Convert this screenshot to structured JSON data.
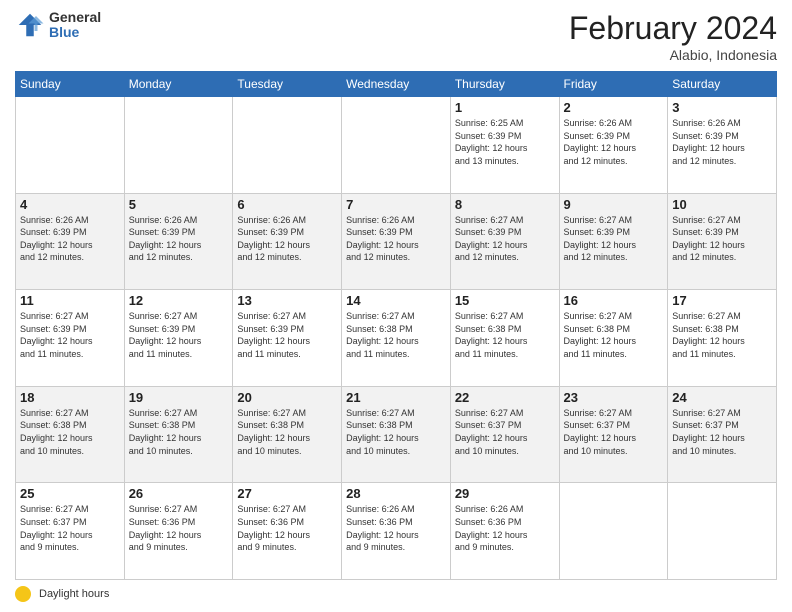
{
  "logo": {
    "general": "General",
    "blue": "Blue"
  },
  "title": "February 2024",
  "subtitle": "Alabio, Indonesia",
  "days_of_week": [
    "Sunday",
    "Monday",
    "Tuesday",
    "Wednesday",
    "Thursday",
    "Friday",
    "Saturday"
  ],
  "footer": {
    "label": "Daylight hours"
  },
  "weeks": [
    [
      {
        "day": "",
        "info": ""
      },
      {
        "day": "",
        "info": ""
      },
      {
        "day": "",
        "info": ""
      },
      {
        "day": "",
        "info": ""
      },
      {
        "day": "1",
        "info": "Sunrise: 6:25 AM\nSunset: 6:39 PM\nDaylight: 12 hours\nand 13 minutes."
      },
      {
        "day": "2",
        "info": "Sunrise: 6:26 AM\nSunset: 6:39 PM\nDaylight: 12 hours\nand 12 minutes."
      },
      {
        "day": "3",
        "info": "Sunrise: 6:26 AM\nSunset: 6:39 PM\nDaylight: 12 hours\nand 12 minutes."
      }
    ],
    [
      {
        "day": "4",
        "info": "Sunrise: 6:26 AM\nSunset: 6:39 PM\nDaylight: 12 hours\nand 12 minutes."
      },
      {
        "day": "5",
        "info": "Sunrise: 6:26 AM\nSunset: 6:39 PM\nDaylight: 12 hours\nand 12 minutes."
      },
      {
        "day": "6",
        "info": "Sunrise: 6:26 AM\nSunset: 6:39 PM\nDaylight: 12 hours\nand 12 minutes."
      },
      {
        "day": "7",
        "info": "Sunrise: 6:26 AM\nSunset: 6:39 PM\nDaylight: 12 hours\nand 12 minutes."
      },
      {
        "day": "8",
        "info": "Sunrise: 6:27 AM\nSunset: 6:39 PM\nDaylight: 12 hours\nand 12 minutes."
      },
      {
        "day": "9",
        "info": "Sunrise: 6:27 AM\nSunset: 6:39 PM\nDaylight: 12 hours\nand 12 minutes."
      },
      {
        "day": "10",
        "info": "Sunrise: 6:27 AM\nSunset: 6:39 PM\nDaylight: 12 hours\nand 12 minutes."
      }
    ],
    [
      {
        "day": "11",
        "info": "Sunrise: 6:27 AM\nSunset: 6:39 PM\nDaylight: 12 hours\nand 11 minutes."
      },
      {
        "day": "12",
        "info": "Sunrise: 6:27 AM\nSunset: 6:39 PM\nDaylight: 12 hours\nand 11 minutes."
      },
      {
        "day": "13",
        "info": "Sunrise: 6:27 AM\nSunset: 6:39 PM\nDaylight: 12 hours\nand 11 minutes."
      },
      {
        "day": "14",
        "info": "Sunrise: 6:27 AM\nSunset: 6:38 PM\nDaylight: 12 hours\nand 11 minutes."
      },
      {
        "day": "15",
        "info": "Sunrise: 6:27 AM\nSunset: 6:38 PM\nDaylight: 12 hours\nand 11 minutes."
      },
      {
        "day": "16",
        "info": "Sunrise: 6:27 AM\nSunset: 6:38 PM\nDaylight: 12 hours\nand 11 minutes."
      },
      {
        "day": "17",
        "info": "Sunrise: 6:27 AM\nSunset: 6:38 PM\nDaylight: 12 hours\nand 11 minutes."
      }
    ],
    [
      {
        "day": "18",
        "info": "Sunrise: 6:27 AM\nSunset: 6:38 PM\nDaylight: 12 hours\nand 10 minutes."
      },
      {
        "day": "19",
        "info": "Sunrise: 6:27 AM\nSunset: 6:38 PM\nDaylight: 12 hours\nand 10 minutes."
      },
      {
        "day": "20",
        "info": "Sunrise: 6:27 AM\nSunset: 6:38 PM\nDaylight: 12 hours\nand 10 minutes."
      },
      {
        "day": "21",
        "info": "Sunrise: 6:27 AM\nSunset: 6:38 PM\nDaylight: 12 hours\nand 10 minutes."
      },
      {
        "day": "22",
        "info": "Sunrise: 6:27 AM\nSunset: 6:37 PM\nDaylight: 12 hours\nand 10 minutes."
      },
      {
        "day": "23",
        "info": "Sunrise: 6:27 AM\nSunset: 6:37 PM\nDaylight: 12 hours\nand 10 minutes."
      },
      {
        "day": "24",
        "info": "Sunrise: 6:27 AM\nSunset: 6:37 PM\nDaylight: 12 hours\nand 10 minutes."
      }
    ],
    [
      {
        "day": "25",
        "info": "Sunrise: 6:27 AM\nSunset: 6:37 PM\nDaylight: 12 hours\nand 9 minutes."
      },
      {
        "day": "26",
        "info": "Sunrise: 6:27 AM\nSunset: 6:36 PM\nDaylight: 12 hours\nand 9 minutes."
      },
      {
        "day": "27",
        "info": "Sunrise: 6:27 AM\nSunset: 6:36 PM\nDaylight: 12 hours\nand 9 minutes."
      },
      {
        "day": "28",
        "info": "Sunrise: 6:26 AM\nSunset: 6:36 PM\nDaylight: 12 hours\nand 9 minutes."
      },
      {
        "day": "29",
        "info": "Sunrise: 6:26 AM\nSunset: 6:36 PM\nDaylight: 12 hours\nand 9 minutes."
      },
      {
        "day": "",
        "info": ""
      },
      {
        "day": "",
        "info": ""
      }
    ]
  ]
}
